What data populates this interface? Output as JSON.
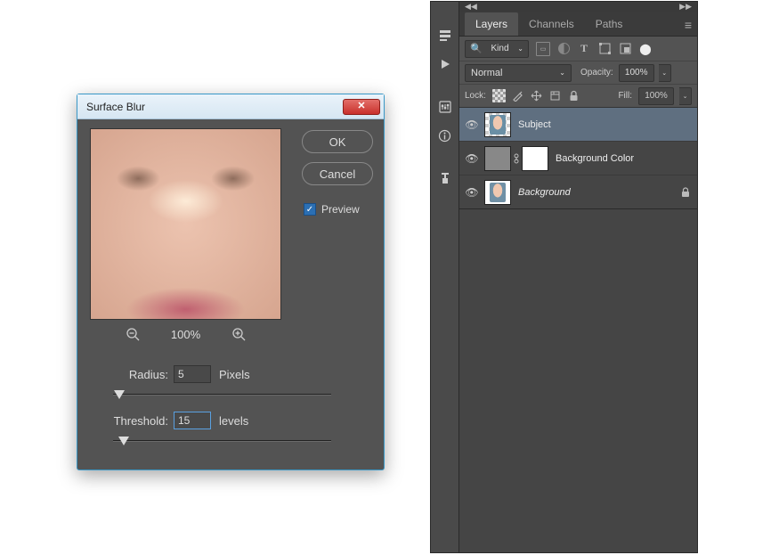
{
  "dialog": {
    "title": "Surface Blur",
    "ok_label": "OK",
    "cancel_label": "Cancel",
    "preview_label": "Preview",
    "preview_checked": true,
    "zoom_pct": "100%",
    "radius_label": "Radius:",
    "radius_value": "5",
    "radius_unit": "Pixels",
    "threshold_label": "Threshold:",
    "threshold_value": "15",
    "threshold_unit": "levels"
  },
  "panel": {
    "tabs": [
      {
        "label": "Layers",
        "active": true
      },
      {
        "label": "Channels",
        "active": false
      },
      {
        "label": "Paths",
        "active": false
      }
    ],
    "filter": {
      "kind_label": "Kind"
    },
    "blend": {
      "mode": "Normal",
      "opacity_label": "Opacity:",
      "opacity_value": "100%"
    },
    "lock": {
      "label": "Lock:",
      "fill_label": "Fill:",
      "fill_value": "100%"
    },
    "layers": [
      {
        "name": "Subject",
        "visible": true,
        "active": true,
        "italic": false,
        "locked": false,
        "type": "image"
      },
      {
        "name": "Background Color",
        "visible": true,
        "active": false,
        "italic": false,
        "locked": false,
        "type": "adjustment"
      },
      {
        "name": "Background",
        "visible": true,
        "active": false,
        "italic": true,
        "locked": true,
        "type": "image"
      }
    ]
  }
}
